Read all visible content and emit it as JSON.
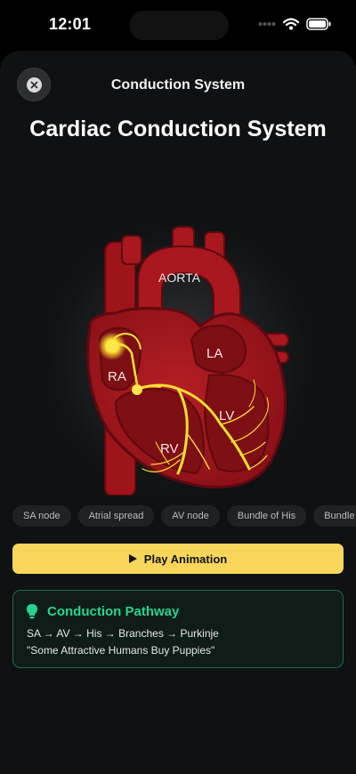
{
  "status_bar": {
    "time": "12:01"
  },
  "header": {
    "nav_title": "Conduction System",
    "page_title": "Cardiac Conduction System"
  },
  "diagram": {
    "labels": {
      "aorta": "AORTA",
      "ra": "RA",
      "la": "LA",
      "lv": "LV",
      "rv": "RV"
    },
    "colors": {
      "heart": "#a3161c",
      "heart_dark": "#5e0a10",
      "pathway": "#ffe033"
    }
  },
  "steps": [
    "SA node",
    "Atrial spread",
    "AV node",
    "Bundle of His",
    "Bundle Branches"
  ],
  "play_button": {
    "label": "Play Animation"
  },
  "info_card": {
    "title": "Conduction Pathway",
    "line1": "SA → AV → His → Branches → Purkinje",
    "line2": "\"Some Attractive Humans Buy Puppies\""
  },
  "colors": {
    "accent": "#f7d65a",
    "success": "#27d391",
    "background": "#0f1113"
  }
}
